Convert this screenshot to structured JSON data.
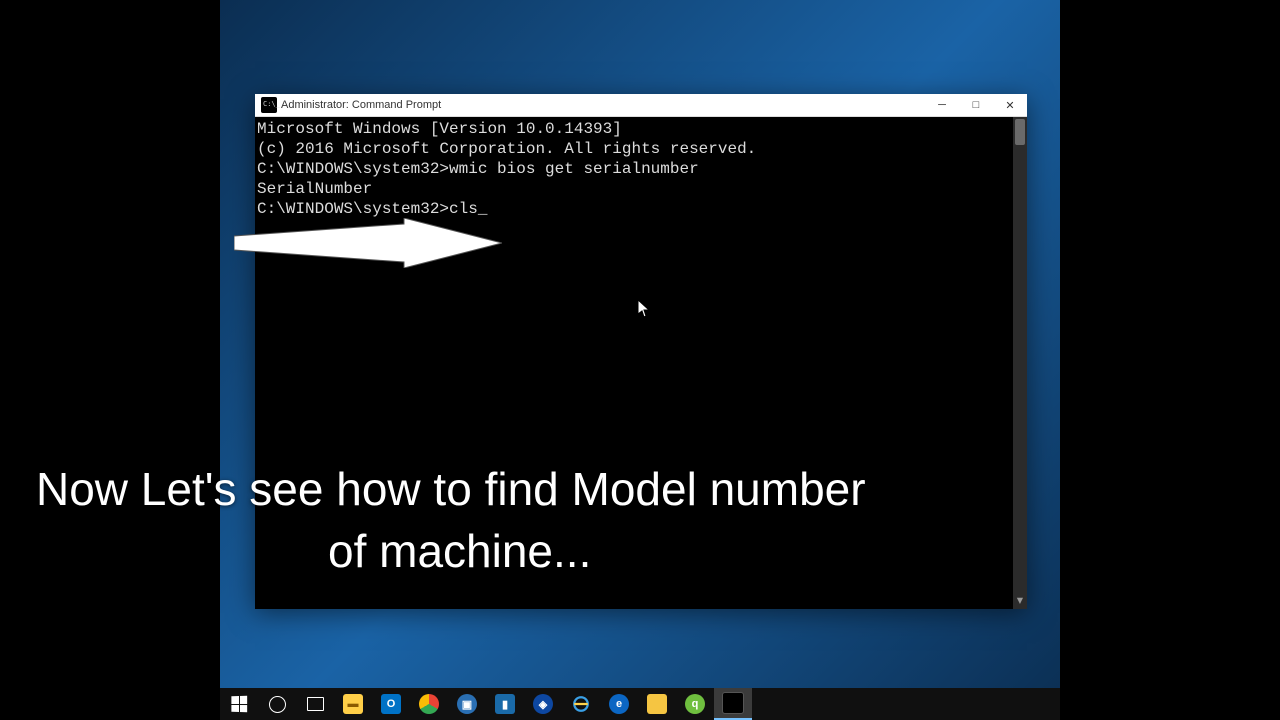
{
  "window": {
    "title": "Administrator: Command Prompt",
    "controls": {
      "min": "─",
      "max": "□",
      "close": "✕"
    }
  },
  "terminal": {
    "line1": "Microsoft Windows [Version 10.0.14393]",
    "line2": "(c) 2016 Microsoft Corporation. All rights reserved.",
    "blank1": "",
    "line3": "C:\\WINDOWS\\system32>wmic bios get serialnumber",
    "line4": "SerialNumber",
    "blank2": "",
    "blank3": "",
    "blank4": "",
    "line5": "C:\\WINDOWS\\system32>cls",
    "cursor": "_"
  },
  "caption": {
    "line1": "Now Let's see how to find Model number",
    "line2": "of machine..."
  }
}
